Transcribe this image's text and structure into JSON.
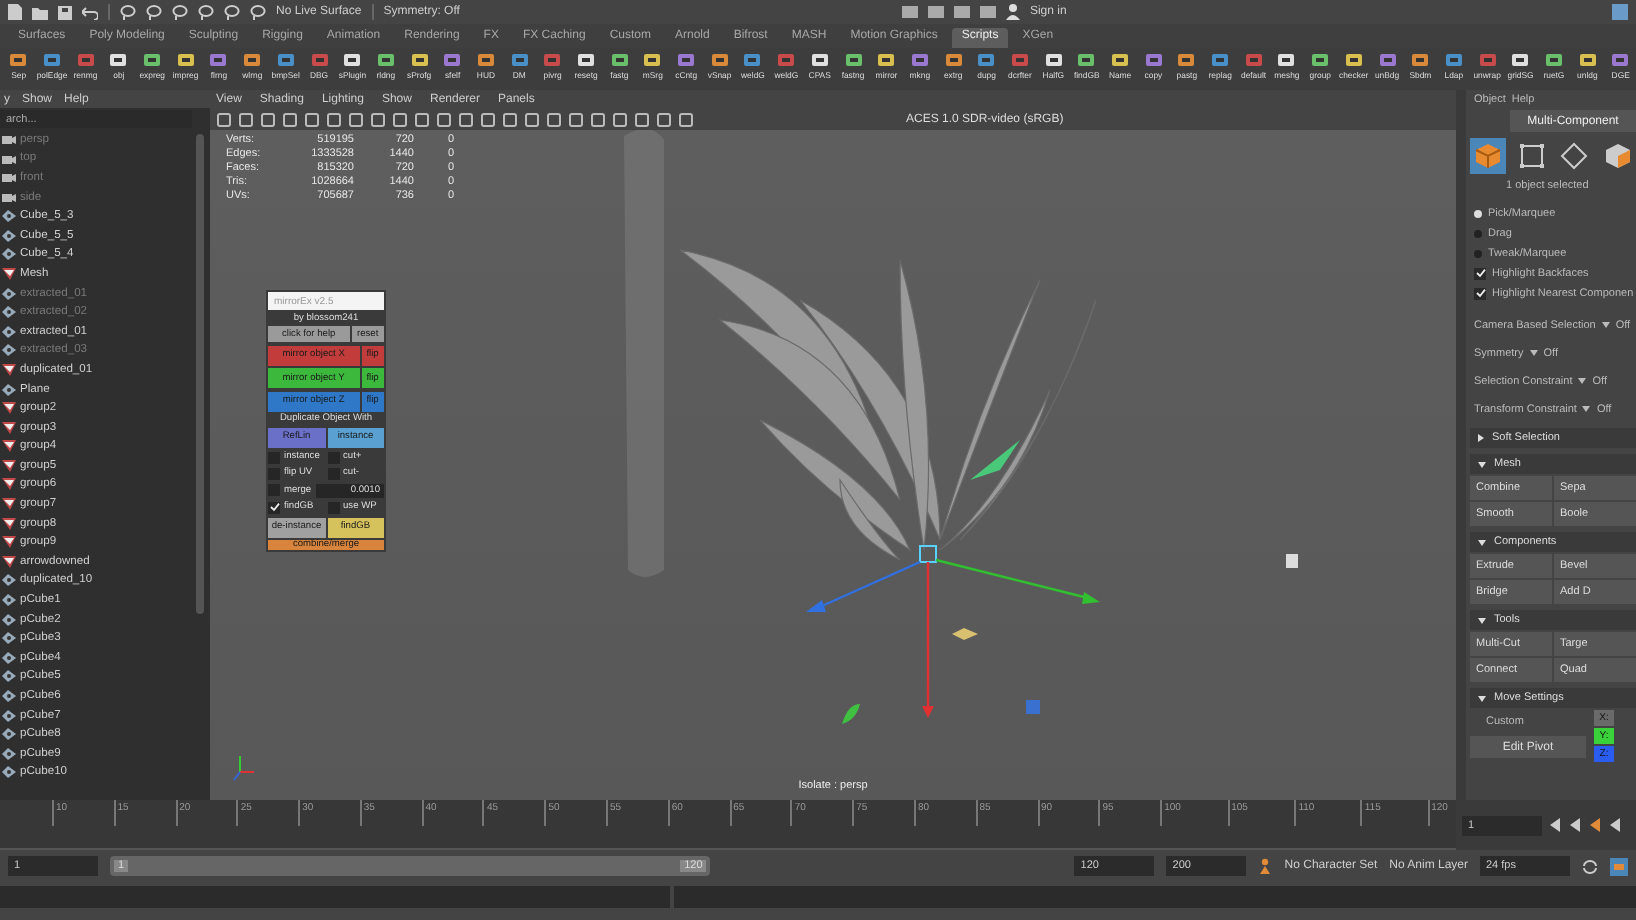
{
  "status_line": {
    "live_surface": "No Live Surface",
    "symmetry": "Symmetry: Off",
    "sign_in": "Sign in"
  },
  "shelf_tabs": [
    {
      "label": "Surfaces",
      "selected": false
    },
    {
      "label": "Poly Modeling",
      "selected": false
    },
    {
      "label": "Sculpting",
      "selected": false
    },
    {
      "label": "Rigging",
      "selected": false
    },
    {
      "label": "Animation",
      "selected": false
    },
    {
      "label": "Rendering",
      "selected": false
    },
    {
      "label": "FX",
      "selected": false
    },
    {
      "label": "FX Caching",
      "selected": false
    },
    {
      "label": "Custom",
      "selected": false
    },
    {
      "label": "Arnold",
      "selected": false
    },
    {
      "label": "Bifrost",
      "selected": false
    },
    {
      "label": "MASH",
      "selected": false
    },
    {
      "label": "Motion Graphics",
      "selected": false
    },
    {
      "label": "Scripts",
      "selected": true
    },
    {
      "label": "XGen",
      "selected": false
    }
  ],
  "shelf_buttons": [
    "Sep",
    "polEdge",
    "renmg",
    "obj",
    "expreg",
    "impreg",
    "flrng",
    "wlrng",
    "bmpSel",
    "DBG",
    "sPlugin",
    "rldng",
    "sProfg",
    "sfelf",
    "HUD",
    "DM",
    "pivrg",
    "resetg",
    "fastg",
    "mSrg",
    "cCntg",
    "vSnap",
    "weldG",
    "weldG",
    "CPAS",
    "fastng",
    "mirror",
    "mkng",
    "extrg",
    "dupg",
    "dcrfter",
    "HalfG",
    "findGB",
    "Name",
    "copy",
    "pastg",
    "replag",
    "default",
    "meshg",
    "group",
    "checker",
    "unBdg",
    "Sbdm",
    "Ldap",
    "unwrap",
    "gridSG",
    "ruetG",
    "unldg",
    "DGE"
  ],
  "outliner": {
    "menus": [
      "y",
      "Show",
      "Help"
    ],
    "search_placeholder": "arch...",
    "items": [
      {
        "label": "persp",
        "kind": "camera",
        "dimmed": true
      },
      {
        "label": "top",
        "kind": "camera",
        "dimmed": true
      },
      {
        "label": "front",
        "kind": "camera",
        "dimmed": true
      },
      {
        "label": "side",
        "kind": "camera",
        "dimmed": true
      },
      {
        "label": "Cube_5_3",
        "kind": "mesh",
        "dimmed": false
      },
      {
        "label": "Cube_5_5",
        "kind": "mesh",
        "dimmed": false
      },
      {
        "label": "Cube_5_4",
        "kind": "mesh",
        "dimmed": false
      },
      {
        "label": "Mesh",
        "kind": "group",
        "dimmed": false
      },
      {
        "label": "extracted_01",
        "kind": "mesh",
        "dimmed": true
      },
      {
        "label": "extracted_02",
        "kind": "mesh",
        "dimmed": true
      },
      {
        "label": "extracted_01",
        "kind": "mesh",
        "dimmed": false
      },
      {
        "label": "extracted_03",
        "kind": "mesh",
        "dimmed": true
      },
      {
        "label": "duplicated_01",
        "kind": "group",
        "dimmed": false
      },
      {
        "label": "Plane",
        "kind": "mesh",
        "dimmed": false
      },
      {
        "label": "group2",
        "kind": "group",
        "dimmed": false
      },
      {
        "label": "group3",
        "kind": "group",
        "dimmed": false
      },
      {
        "label": "group4",
        "kind": "group",
        "dimmed": false
      },
      {
        "label": "group5",
        "kind": "group",
        "dimmed": false
      },
      {
        "label": "group6",
        "kind": "group",
        "dimmed": false
      },
      {
        "label": "group7",
        "kind": "group",
        "dimmed": false
      },
      {
        "label": "group8",
        "kind": "group",
        "dimmed": false
      },
      {
        "label": "group9",
        "kind": "group",
        "dimmed": false
      },
      {
        "label": "arrowdowned",
        "kind": "group",
        "dimmed": false
      },
      {
        "label": "duplicated_10",
        "kind": "mesh",
        "dimmed": false
      },
      {
        "label": "pCube1",
        "kind": "mesh",
        "dimmed": false
      },
      {
        "label": "pCube2",
        "kind": "mesh",
        "dimmed": false
      },
      {
        "label": "pCube3",
        "kind": "mesh",
        "dimmed": false
      },
      {
        "label": "pCube4",
        "kind": "mesh",
        "dimmed": false
      },
      {
        "label": "pCube5",
        "kind": "mesh",
        "dimmed": false
      },
      {
        "label": "pCube6",
        "kind": "mesh",
        "dimmed": false
      },
      {
        "label": "pCube7",
        "kind": "mesh",
        "dimmed": false
      },
      {
        "label": "pCube8",
        "kind": "mesh",
        "dimmed": false
      },
      {
        "label": "pCube9",
        "kind": "mesh",
        "dimmed": false
      },
      {
        "label": "pCube10",
        "kind": "mesh",
        "dimmed": false
      }
    ]
  },
  "viewport": {
    "menus": [
      "View",
      "Shading",
      "Lighting",
      "Show",
      "Renderer",
      "Panels"
    ],
    "color_space": "ACES 1.0 SDR-video (sRGB)",
    "stats": [
      {
        "label": "Verts:",
        "values": [
          "519195",
          "720",
          "0"
        ]
      },
      {
        "label": "Edges:",
        "values": [
          "1333528",
          "1440",
          "0"
        ]
      },
      {
        "label": "Faces:",
        "values": [
          "815320",
          "720",
          "0"
        ]
      },
      {
        "label": "Tris:",
        "values": [
          "1028664",
          "1440",
          "0"
        ]
      },
      {
        "label": "UVs:",
        "values": [
          "705687",
          "736",
          "0"
        ]
      }
    ],
    "camera_label": "Isolate : persp"
  },
  "tool_window": {
    "title": "mirrorEx v2.5",
    "author": "by blossom241",
    "help": "click for help",
    "reset": "reset",
    "mirror_rows": [
      {
        "label": "mirror object X",
        "flip": "flip",
        "color": "#c23c3c"
      },
      {
        "label": "mirror object Y",
        "flip": "flip",
        "color": "#3cb83c"
      },
      {
        "label": "mirror object Z",
        "flip": "flip",
        "color": "#2f78c8"
      }
    ],
    "duplicate_heading": "Duplicate Object With",
    "duplicate_modes": [
      {
        "label": "RefLin",
        "selected": true
      },
      {
        "label": "instance",
        "selected": false
      }
    ],
    "options": [
      {
        "label": "instance",
        "checked": false
      },
      {
        "label": "cut+",
        "checked": false
      },
      {
        "label": "flip UV",
        "checked": false
      },
      {
        "label": "cut-",
        "checked": false
      }
    ],
    "merge": {
      "label": "merge",
      "checked": false,
      "value": "0.0010"
    },
    "options2": [
      {
        "label": "findGB",
        "checked": true
      },
      {
        "label": "use WP",
        "checked": false
      }
    ],
    "actions": [
      {
        "label": "de-instance",
        "color": "#a0a0a0"
      },
      {
        "label": "findGB",
        "color": "#d6c25c"
      }
    ],
    "combine": "combine/merge"
  },
  "modeling_toolkit": {
    "menus": [
      "Object",
      "Help"
    ],
    "mode_button": "Multi-Component",
    "selection_modes": [
      {
        "kind": "object",
        "selected": true
      },
      {
        "kind": "vertex",
        "selected": false
      },
      {
        "kind": "edge",
        "selected": false
      },
      {
        "kind": "face",
        "selected": false
      }
    ],
    "selected_count": "1 object selected",
    "pick_modes": [
      {
        "label": "Pick/Marquee",
        "selected": true
      },
      {
        "label": "Drag",
        "selected": false
      },
      {
        "label": "Tweak/Marquee",
        "selected": false
      }
    ],
    "highlights": [
      {
        "label": "Highlight Backfaces",
        "checked": true
      },
      {
        "label": "Highlight Nearest Componen",
        "checked": true
      }
    ],
    "settings": [
      {
        "label": "Camera Based Selection",
        "value": "Off"
      },
      {
        "label": "Symmetry",
        "value": "Off"
      },
      {
        "label": "Selection Constraint",
        "value": "Off"
      },
      {
        "label": "Transform Constraint",
        "value": "Off"
      }
    ],
    "sections": [
      {
        "title": "Soft Selection",
        "expanded": false
      },
      {
        "title": "Mesh",
        "expanded": true,
        "buttons": [
          "Combine",
          "Sepa",
          "Smooth",
          "Boole"
        ]
      },
      {
        "title": "Components",
        "expanded": true,
        "buttons": [
          "Extrude",
          "Bevel",
          "Bridge",
          "Add D"
        ]
      },
      {
        "title": "Tools",
        "expanded": true,
        "buttons": [
          "Multi-Cut",
          "Targe",
          "Connect",
          "Quad"
        ]
      }
    ],
    "move_settings": {
      "title": "Move Settings",
      "expanded": true,
      "preset": "Custom",
      "axes": [
        {
          "label": "X:",
          "color": "#6a6a6a"
        },
        {
          "label": "Y:",
          "color": "#3ad23a"
        },
        {
          "label": "Z:",
          "color": "#2a5cf0"
        }
      ],
      "edit_pivot": "Edit Pivot"
    }
  },
  "timeline": {
    "ticks": [
      "10",
      "15",
      "20",
      "25",
      "30",
      "35",
      "40",
      "45",
      "50",
      "55",
      "60",
      "65",
      "70",
      "75",
      "80",
      "85",
      "90",
      "95",
      "100",
      "105",
      "110",
      "115",
      "120"
    ],
    "current_frame": "1"
  },
  "range": {
    "level": 1,
    "start": "1",
    "range_start": "1",
    "range_end": "120",
    "end": "120",
    "max": "200",
    "character_set": "No Character Set",
    "anim_layer": "No Anim Layer",
    "fps": "24 fps"
  }
}
